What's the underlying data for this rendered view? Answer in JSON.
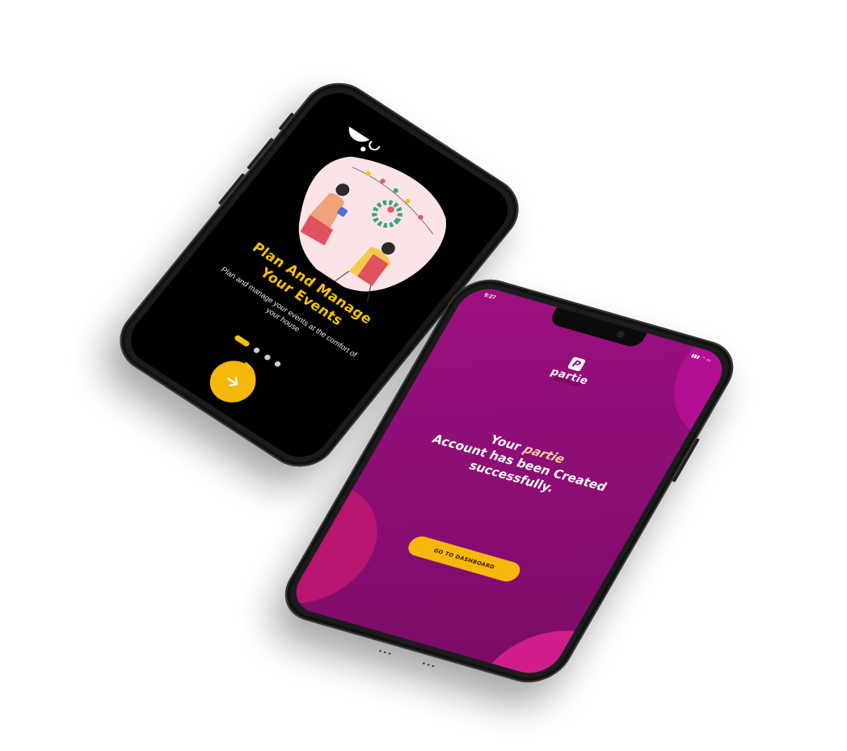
{
  "onboarding": {
    "title_line1": "Plan And Manage",
    "title_line2": "Your Events",
    "subtitle": "Plan and manage your events at the comfort of your house",
    "pagination": {
      "total": 4,
      "active": 1
    },
    "next_icon": "arrow-right-icon",
    "illustration": "party-couple-illustration"
  },
  "success": {
    "status_time": "9:27",
    "status_icons": "signal-wifi-battery",
    "brand_mark": "P",
    "brand_name": "partie",
    "message_prefix": "Your ",
    "message_brand": "partie",
    "message_rest": "Account has been Created successfully.",
    "cta_label": "GO TO DASHBOARD"
  },
  "colors": {
    "onboarding_bg": "#000000",
    "accent_yellow": "#f4c20d",
    "success_bg": "#8e0d77",
    "success_highlight": "#f6d3a3",
    "button_yellow": "#f6b80c"
  }
}
